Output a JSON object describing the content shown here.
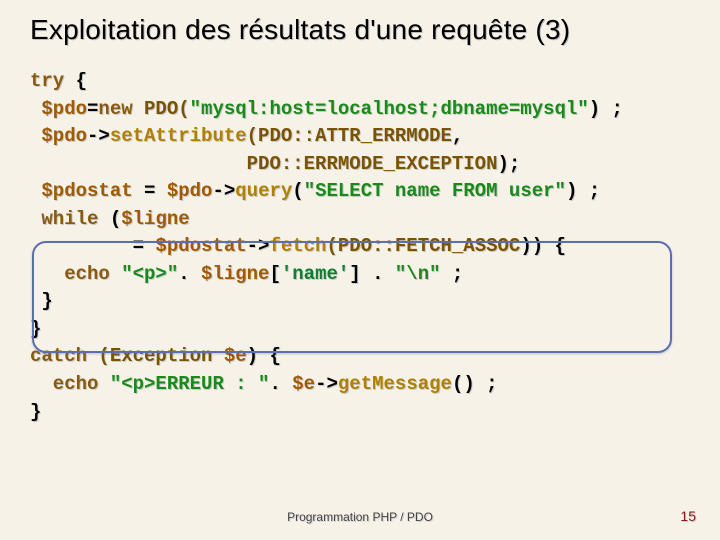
{
  "title": "Exploitation des résultats d'une requête (3)",
  "footer": "Programmation PHP / PDO",
  "page_number": "15",
  "code": {
    "l01a": "try",
    "l01b": " {",
    "l02a": " $pdo",
    "l02b": "=",
    "l02c": "new ",
    "l02d": "PDO(",
    "l02e": "\"mysql:host=localhost;dbname=mysql\"",
    "l02f": ") ;",
    "l03a": " $pdo",
    "l03b": "->",
    "l03c": "setAttribute",
    "l03d": "(PDO::",
    "l03e": "ATTR_ERRMODE",
    "l03f": ",",
    "l04a": "                   PDO::",
    "l04b": "ERRMODE_EXCEPTION",
    "l04c": ");",
    "l05a": " $pdostat",
    "l05b": " = ",
    "l05c": "$pdo",
    "l05d": "->",
    "l05e": "query",
    "l05f": "(",
    "l05g": "\"SELECT name FROM user\"",
    "l05h": ") ;",
    "l06a": " while ",
    "l06b": "(",
    "l06c": "$ligne",
    "l07a": "         = ",
    "l07b": "$pdostat",
    "l07c": "->",
    "l07d": "fetch",
    "l07e": "(PDO::",
    "l07f": "FETCH_ASSOC",
    "l07g": ")) {",
    "l08a": "   echo ",
    "l08b": "\"<p>\"",
    "l08c": ". ",
    "l08d": "$ligne",
    "l08e": "[",
    "l08f": "'name'",
    "l08g": "] . ",
    "l08h": "\"\\n\"",
    "l08i": " ;",
    "l09a": " }",
    "l10a": "}",
    "l11a": "catch ",
    "l11b": "(Exception ",
    "l11c": "$e",
    "l11d": ") {",
    "l12a": "  echo ",
    "l12b": "\"<p>ERREUR : \"",
    "l12c": ". ",
    "l12d": "$e",
    "l12e": "->",
    "l12f": "getMessage",
    "l12g": "() ;",
    "l13a": "}"
  }
}
